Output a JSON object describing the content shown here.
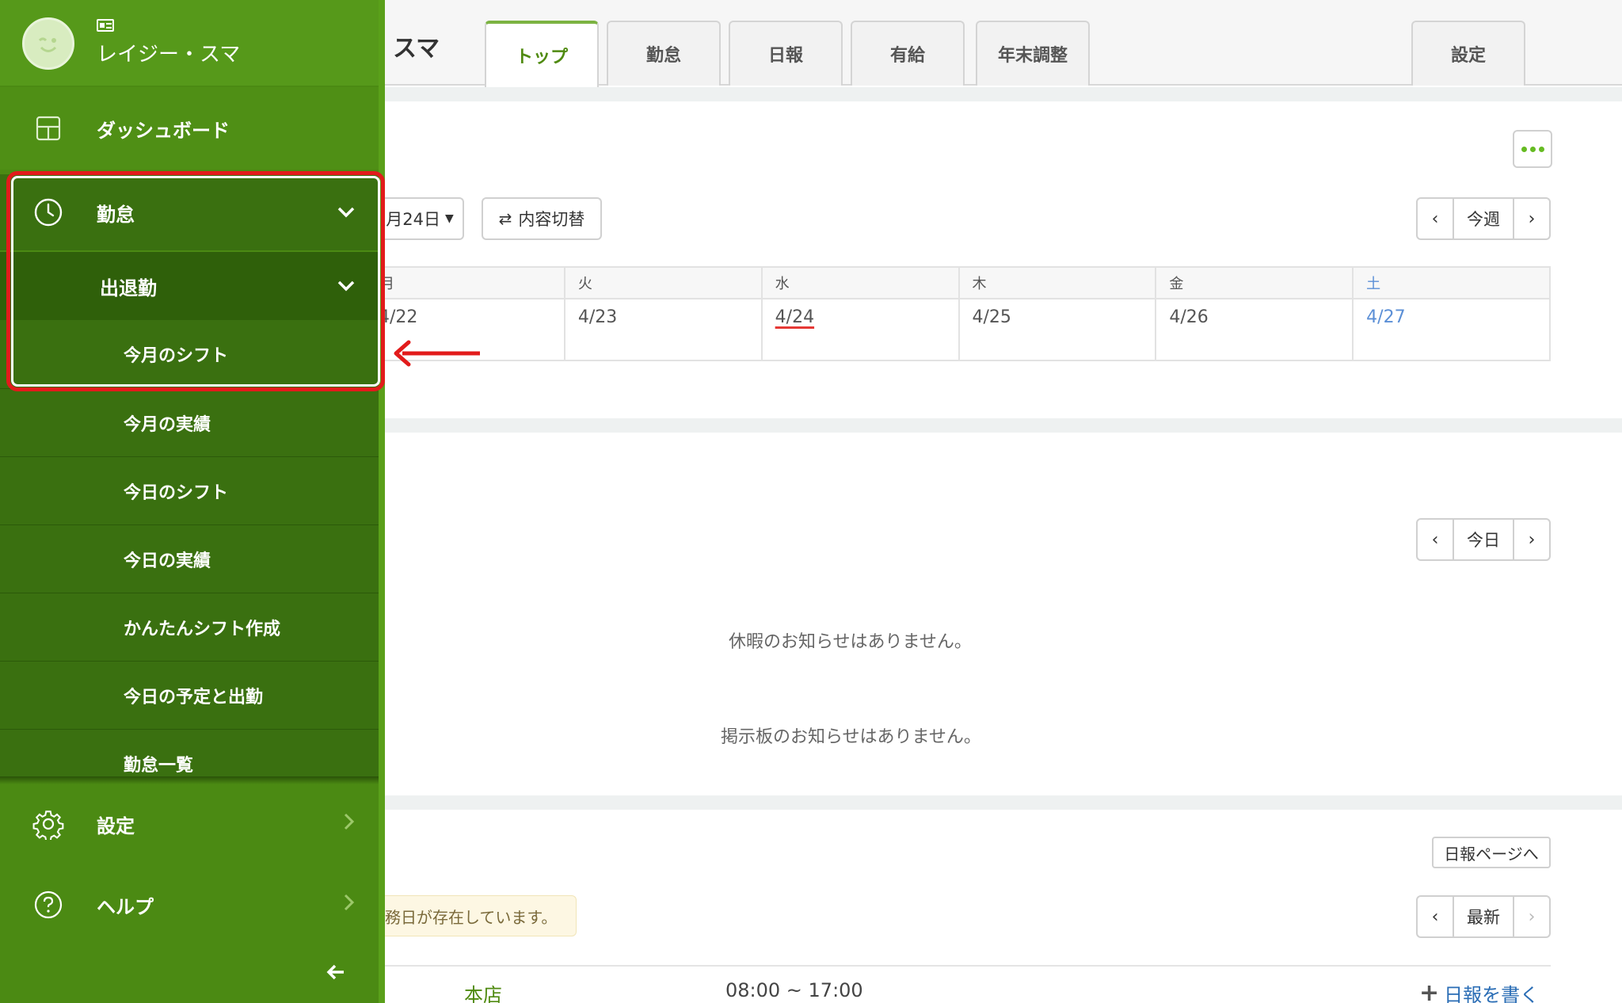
{
  "header": {
    "title_fragment": "スマ",
    "tabs": [
      {
        "label": "トップ",
        "active": true
      },
      {
        "label": "勤怠",
        "active": false
      },
      {
        "label": "日報",
        "active": false
      },
      {
        "label": "有給",
        "active": false
      },
      {
        "label": "年末調整",
        "active": false
      }
    ],
    "settings_tab": "設定"
  },
  "week_section": {
    "date_selector": "月24日",
    "toggle_button": "内容切替",
    "nav": {
      "prev": "‹",
      "current": "今週",
      "next": "›"
    },
    "days": [
      "月",
      "火",
      "水",
      "木",
      "金",
      "土"
    ],
    "dates": [
      "4/22",
      "4/23",
      "4/24",
      "4/25",
      "4/26",
      "4/27"
    ],
    "today_date": "4/24"
  },
  "notice_section": {
    "nav": {
      "prev": "‹",
      "current": "今日",
      "next": "›"
    },
    "vacation_notice": "休暇のお知らせはありません。",
    "board_notice": "掲示板のお知らせはありません。"
  },
  "report_section": {
    "report_page_button": "日報ページへ",
    "warning_text": "務日が存在しています。",
    "nav": {
      "prev": "‹",
      "current": "最新",
      "next": "›"
    },
    "store": "本店",
    "time": "08:00 ~ 17:00",
    "write_report": "日報を書く"
  },
  "sidebar": {
    "user_name": "レイジー・スマ",
    "dashboard": "ダッシュボード",
    "kintai": "勤怠",
    "shukkin": "出退勤",
    "sub_items": [
      "今月のシフト",
      "今月の実績",
      "今日のシフト",
      "今日の実績",
      "かんたんシフト作成",
      "今日の予定と出勤",
      "勤怠一覧"
    ],
    "settings": "設定",
    "help": "ヘルプ"
  },
  "colors": {
    "sidebar_green": "#4b8a13",
    "accent_green": "#4f8a10",
    "highlight_red": "#e21b1b",
    "saturday_blue": "#5b8fd6",
    "link_blue": "#2a6db5"
  }
}
